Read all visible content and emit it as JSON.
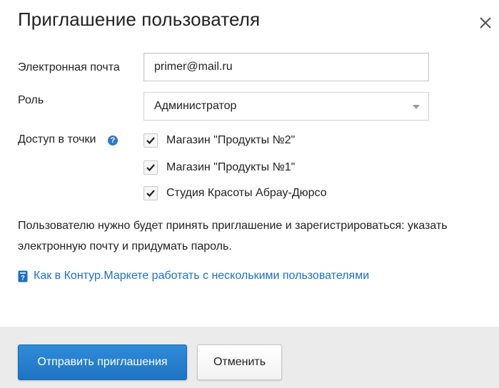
{
  "dialog": {
    "title": "Приглашение пользователя",
    "close_icon": "close-icon"
  },
  "form": {
    "email": {
      "label": "Электронная почта",
      "value": "primer@mail.ru"
    },
    "role": {
      "label": "Роль",
      "selected": "Администратор",
      "arrow_icon": "chevron-down-icon"
    },
    "access": {
      "label": "Доступ в точки",
      "help_icon": "question-icon",
      "help_glyph": "?",
      "items": [
        {
          "label": "Магазин \"Продукты №2\"",
          "checked": true
        },
        {
          "label": "Магазин \"Продукты №1\"",
          "checked": true
        },
        {
          "label": "Студия Красоты Абрау-Дюрсо",
          "checked": true
        }
      ]
    }
  },
  "note": "Пользователю нужно будет принять приглашение и зарегистрироваться: указать электронную почту и придумать пароль.",
  "help_link": {
    "icon": "book-icon",
    "text": "Как в Контур.Маркете работать с несколькими пользователями"
  },
  "footer": {
    "send_label": "Отправить приглашения",
    "cancel_label": "Отменить"
  },
  "colors": {
    "primary": "#1f74c2",
    "link": "#1f6fbd",
    "footer_bg": "#ebebeb"
  }
}
